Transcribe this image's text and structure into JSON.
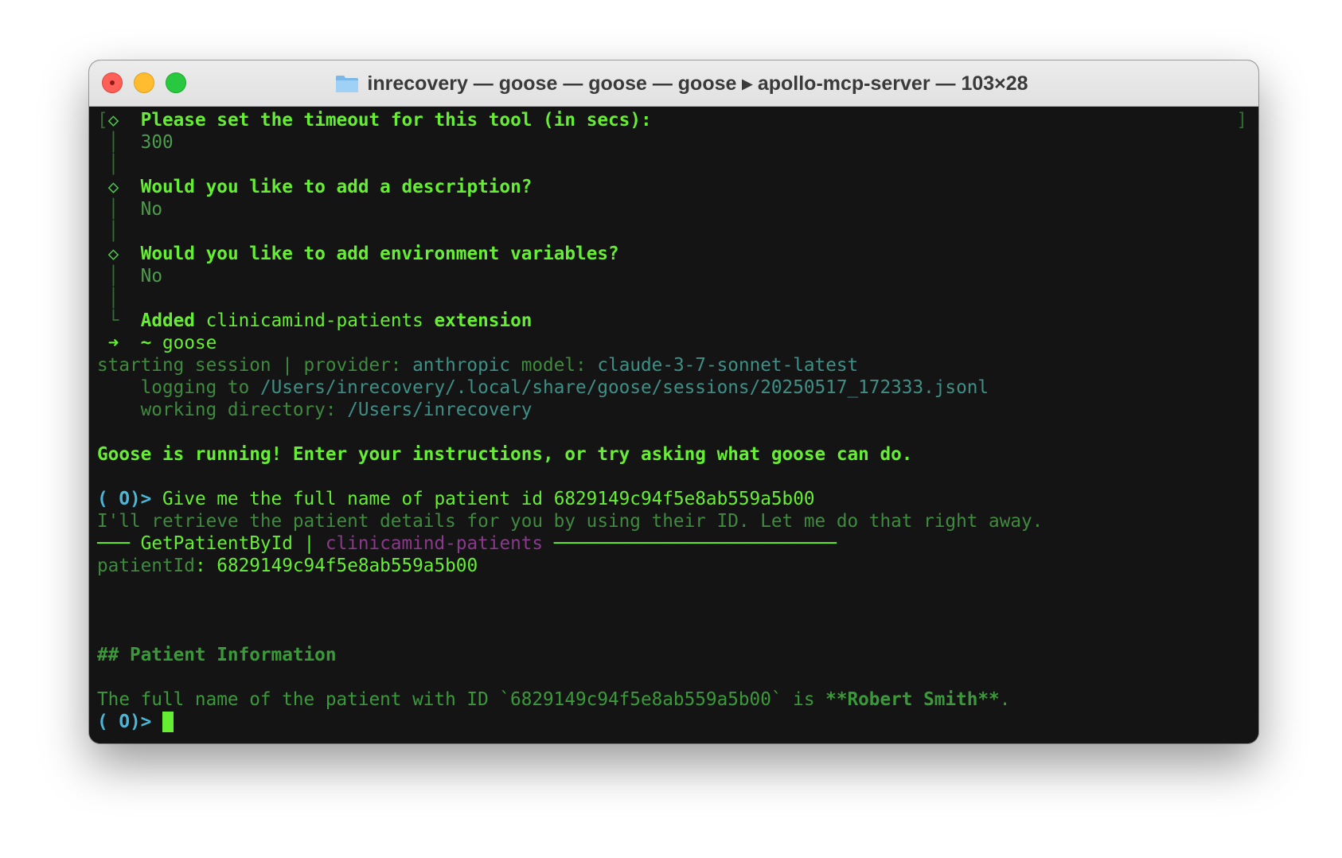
{
  "window": {
    "title": "inrecovery — goose — goose — goose ▸ apollo-mcp-server — 103×28",
    "title_icon": "folder-icon",
    "controls": [
      "close-icon",
      "minimize-icon",
      "maximize-icon"
    ]
  },
  "terminal": {
    "open_bracket": "[",
    "close_bracket": "]",
    "diamond": "◇",
    "pipe": "│",
    "corner": "└",
    "arrow": "➜",
    "q1": {
      "question": "Please set the timeout for this tool (in secs):",
      "answer": "300"
    },
    "q2": {
      "question": "Would you like to add a description?",
      "answer": "No"
    },
    "q3": {
      "question": "Would you like to add environment variables?",
      "answer": "No"
    },
    "added": {
      "prefix": "Added",
      "name": "clinicamind-patients",
      "suffix": "extension"
    },
    "shell_prompt": {
      "path": "~",
      "command": "goose"
    },
    "session": {
      "starting": "starting session | provider:",
      "provider": "anthropic",
      "model_label": "model:",
      "model": "claude-3-7-sonnet-latest",
      "logging_label": "logging to",
      "logging_path": "/Users/inrecovery/.local/share/goose/sessions/20250517_172333.jsonl",
      "workdir_label": "working directory:",
      "workdir_path": "/Users/inrecovery"
    },
    "running_msg": "Goose is running! Enter your instructions, or try asking what goose can do.",
    "prompt_symbol": "( O)>",
    "user_input": "Give me the full name of patient id 6829149c94f5e8ab559a5b00",
    "assistant_intro": "I'll retrieve the patient details for you by using their ID. Let me do that right away.",
    "tool_call": {
      "lead_rule": "───",
      "tool": "GetPatientById",
      "sep": "|",
      "extension": "clinicamind-patients",
      "tail_rule": "──────────────────────────"
    },
    "param": {
      "key": "patientId",
      "colon": ":",
      "value": "6829149c94f5e8ab559a5b00"
    },
    "heading": "## Patient Information",
    "answer": {
      "pre": "The full name of the patient with ID `6829149c94f5e8ab559a5b00` is ",
      "name": "**Robert Smith**",
      "post": "."
    }
  }
}
